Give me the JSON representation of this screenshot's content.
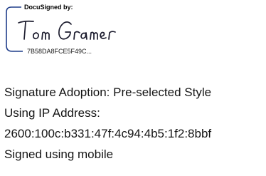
{
  "stamp": {
    "header": "DocuSigned by:",
    "signature_name": "Tom Gramer",
    "envelope_id": "7B58DA8FCE5F49C...",
    "frame_color": "#1f3d8a",
    "ink_color": "#1c1c2e"
  },
  "details": {
    "adoption": "Signature Adoption: Pre-selected Style",
    "ip_label": "Using IP Address:",
    "ip_address": "2600:100c:b331:47f:4c94:4b5:1f2:8bbf",
    "device": "Signed using mobile"
  }
}
